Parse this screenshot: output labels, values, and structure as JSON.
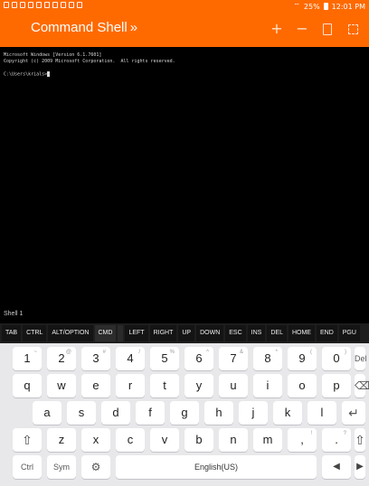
{
  "status_bar": {
    "battery": "25%",
    "time": "12:01 PM"
  },
  "app_bar": {
    "title": "Command Shell",
    "chevron": "»",
    "add_label": "+",
    "remove_label": "−",
    "icons": [
      "plus-icon",
      "minus-icon",
      "clipboard-icon",
      "keyboard-icon",
      "fullscreen-icon"
    ]
  },
  "terminal": {
    "lines": [
      "Microsoft Windows [Version 6.1.7601]",
      "Copyright (c) 2009 Microsoft Corporation.  All rights reserved.",
      "",
      "C:\\Users\\krials>"
    ]
  },
  "shell_label": "Shell 1",
  "extra_keys": [
    "TAB",
    "CTRL",
    "ALT/OPTION",
    "CMD",
    "LEFT",
    "RIGHT",
    "UP",
    "DOWN",
    "ESC",
    "INS",
    "DEL",
    "HOME",
    "END",
    "PGU"
  ],
  "keyboard": {
    "row1": [
      {
        "k": "1",
        "s": "~"
      },
      {
        "k": "2",
        "s": "@"
      },
      {
        "k": "3",
        "s": "#"
      },
      {
        "k": "4",
        "s": "/"
      },
      {
        "k": "5",
        "s": "%"
      },
      {
        "k": "6",
        "s": "^"
      },
      {
        "k": "7",
        "s": "&"
      },
      {
        "k": "8",
        "s": "*"
      },
      {
        "k": "9",
        "s": "("
      },
      {
        "k": "0",
        "s": ")"
      }
    ],
    "del_label": "Del",
    "row2": [
      "q",
      "w",
      "e",
      "r",
      "t",
      "y",
      "u",
      "i",
      "o",
      "p"
    ],
    "row3": [
      "a",
      "s",
      "d",
      "f",
      "g",
      "h",
      "j",
      "k",
      "l"
    ],
    "row4": [
      "z",
      "x",
      "c",
      "v",
      "b",
      "n",
      "m",
      ",",
      "."
    ],
    "row4_sup": {
      ",": "!",
      ".": "?"
    },
    "ctrl_label": "Ctrl",
    "sym_label": "Sym",
    "space_label": "English(US)"
  }
}
